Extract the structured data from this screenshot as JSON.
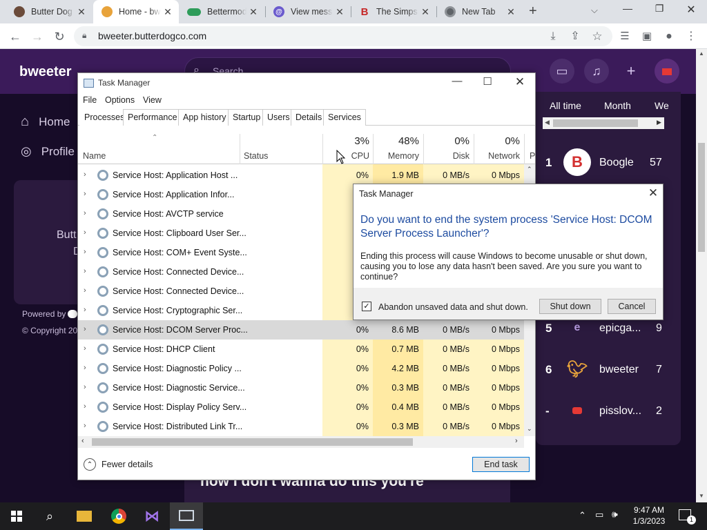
{
  "browser": {
    "tabs": [
      {
        "title": "Butter Dog",
        "favicon": "circle-avatar",
        "active": false
      },
      {
        "title": "Home - bw",
        "favicon": "bird-icon",
        "active": true
      },
      {
        "title": "Bettermod",
        "favicon": "toggle-icon",
        "active": false
      },
      {
        "title": "View mess",
        "favicon": "at-icon",
        "active": false
      },
      {
        "title": "The Simps",
        "favicon": "b-icon",
        "active": false
      },
      {
        "title": "New Tab",
        "favicon": "chrome-icon",
        "active": false
      }
    ],
    "url": "bweeter.butterdogco.com"
  },
  "site": {
    "logo": "bweeter",
    "search_placeholder": "Search",
    "nav": [
      {
        "label": "Home"
      },
      {
        "label": "Profile"
      }
    ],
    "side_card_text": [
      "Butt",
      "D"
    ],
    "powered_by": "Powered by",
    "copyright": "© Copyright 20",
    "feed_text": "now I don't wanna do this you're",
    "leaderboard": {
      "tabs": [
        "All time",
        "Month",
        "We"
      ],
      "entries": [
        {
          "rank": "1",
          "name": "Boogle",
          "score": "57",
          "avatar": "B"
        },
        {
          "rank": "5",
          "name": "epicga...",
          "score": "9",
          "avatar": "e"
        },
        {
          "rank": "6",
          "name": "bweeter",
          "score": "7",
          "avatar": "bird"
        },
        {
          "rank": "-",
          "name": "pisslov...",
          "score": "2",
          "avatar": "flag"
        }
      ]
    }
  },
  "task_manager": {
    "title": "Task Manager",
    "menu": [
      "File",
      "Options",
      "View"
    ],
    "tabs": [
      "Processes",
      "Performance",
      "App history",
      "Startup",
      "Users",
      "Details",
      "Services"
    ],
    "columns": {
      "name": "Name",
      "status": "Status",
      "cpu": {
        "label": "CPU",
        "pct": "3%"
      },
      "memory": {
        "label": "Memory",
        "pct": "48%"
      },
      "disk": {
        "label": "Disk",
        "pct": "0%"
      },
      "network": {
        "label": "Network",
        "pct": "0%"
      },
      "power": "P"
    },
    "processes": [
      {
        "name": "Service Host: Application Host ...",
        "cpu": "0%",
        "mem": "1.9 MB",
        "disk": "0 MB/s",
        "net": "0 Mbps"
      },
      {
        "name": "Service Host: Application Infor...",
        "cpu": "",
        "mem": "",
        "disk": "",
        "net": ""
      },
      {
        "name": "Service Host: AVCTP service",
        "cpu": "",
        "mem": "",
        "disk": "",
        "net": ""
      },
      {
        "name": "Service Host: Clipboard User Ser...",
        "cpu": "",
        "mem": "",
        "disk": "",
        "net": ""
      },
      {
        "name": "Service Host: COM+ Event Syste...",
        "cpu": "",
        "mem": "",
        "disk": "",
        "net": ""
      },
      {
        "name": "Service Host: Connected Device...",
        "cpu": "",
        "mem": "",
        "disk": "",
        "net": ""
      },
      {
        "name": "Service Host: Connected Device...",
        "cpu": "",
        "mem": "",
        "disk": "",
        "net": ""
      },
      {
        "name": "Service Host: Cryptographic Ser...",
        "cpu": "",
        "mem": "",
        "disk": "",
        "net": ""
      },
      {
        "name": "Service Host: DCOM Server Proc...",
        "cpu": "0%",
        "mem": "8.6 MB",
        "disk": "0 MB/s",
        "net": "0 Mbps"
      },
      {
        "name": "Service Host: DHCP Client",
        "cpu": "0%",
        "mem": "0.7 MB",
        "disk": "0 MB/s",
        "net": "0 Mbps"
      },
      {
        "name": "Service Host: Diagnostic Policy ...",
        "cpu": "0%",
        "mem": "4.2 MB",
        "disk": "0 MB/s",
        "net": "0 Mbps"
      },
      {
        "name": "Service Host: Diagnostic Service...",
        "cpu": "0%",
        "mem": "0.3 MB",
        "disk": "0 MB/s",
        "net": "0 Mbps"
      },
      {
        "name": "Service Host: Display Policy Serv...",
        "cpu": "0%",
        "mem": "0.4 MB",
        "disk": "0 MB/s",
        "net": "0 Mbps"
      },
      {
        "name": "Service Host: Distributed Link Tr...",
        "cpu": "0%",
        "mem": "0.3 MB",
        "disk": "0 MB/s",
        "net": "0 Mbps"
      }
    ],
    "fewer_details": "Fewer details",
    "end_task": "End task"
  },
  "dialog": {
    "title": "Task Manager",
    "heading": "Do you want to end the system process 'Service Host: DCOM Server Process Launcher'?",
    "body": "Ending this process will cause Windows to become unusable or shut down, causing you to lose any data hasn't been saved. Are you sure you want to continue?",
    "checkbox_label": "Abandon unsaved data and shut down.",
    "checkbox_checked": true,
    "shutdown": "Shut down",
    "cancel": "Cancel"
  },
  "taskbar": {
    "time": "9:47 AM",
    "date": "1/3/2023",
    "notification_count": "1"
  }
}
